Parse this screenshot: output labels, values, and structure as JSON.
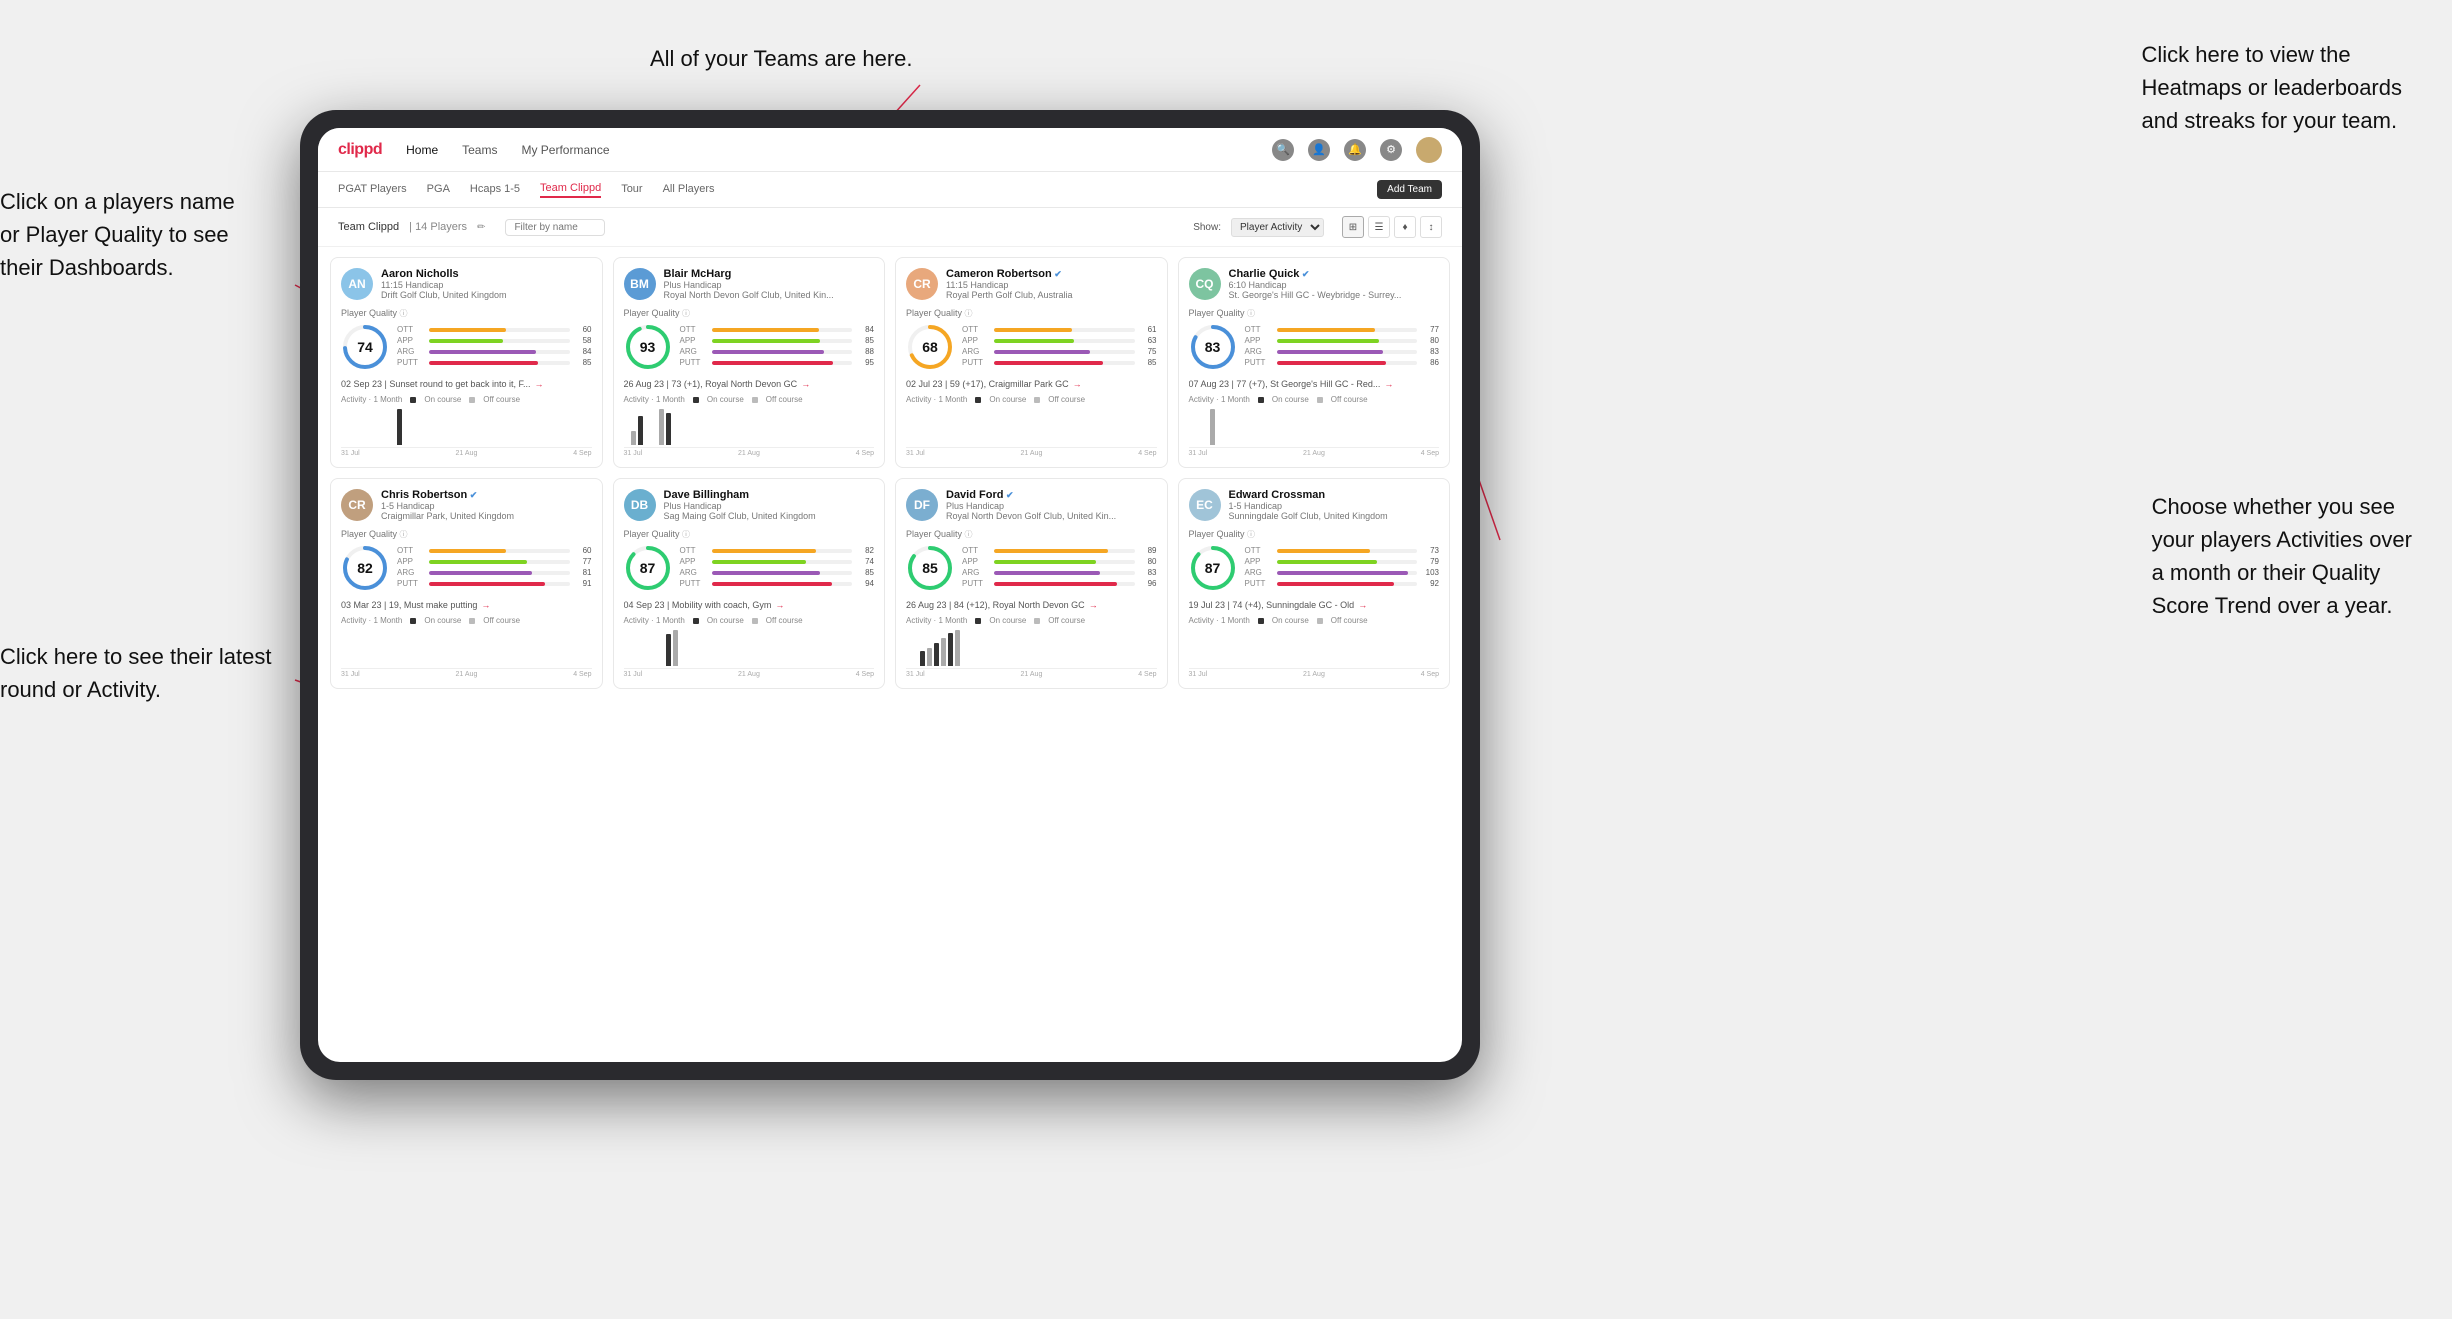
{
  "annotations": {
    "top_center": "All of your Teams are here.",
    "top_right_title": "Click here to view the",
    "top_right_line2": "Heatmaps or leaderboards",
    "top_right_line3": "and streaks for your team.",
    "left_top_title": "Click on a players name",
    "left_top_line2": "or Player Quality to see",
    "left_top_line3": "their Dashboards.",
    "left_bottom_title": "Click here to see their latest",
    "left_bottom_line2": "round or Activity.",
    "right_bottom_title": "Choose whether you see",
    "right_bottom_line2": "your players Activities over",
    "right_bottom_line3": "a month or their Quality",
    "right_bottom_line4": "Score Trend over a year."
  },
  "nav": {
    "logo": "clippd",
    "items": [
      "Home",
      "Teams",
      "My Performance"
    ],
    "add_team": "Add Team"
  },
  "sub_nav": {
    "items": [
      "PGAT Players",
      "PGA",
      "Hcaps 1-5",
      "Team Clippd",
      "Tour",
      "All Players"
    ]
  },
  "team_header": {
    "title": "Team Clippd",
    "count": "14 Players",
    "show_label": "Show:",
    "show_value": "Player Activity",
    "filter_placeholder": "Filter by name"
  },
  "players": [
    {
      "name": "Aaron Nicholls",
      "handicap": "11:15 Handicap",
      "club": "Drift Golf Club, United Kingdom",
      "quality": 74,
      "color": "#4a90d9",
      "stats": [
        {
          "label": "OTT",
          "value": 60,
          "color": "#f5a623"
        },
        {
          "label": "APP",
          "value": 58,
          "color": "#7ed321"
        },
        {
          "label": "ARG",
          "value": 84,
          "color": "#9b59b6"
        },
        {
          "label": "PUTT",
          "value": 85,
          "color": "#e0294a"
        }
      ],
      "last_round": "02 Sep 23 | Sunset round to get back into it, F...",
      "activity_bars": [
        0,
        0,
        0,
        0,
        0,
        0,
        0,
        0,
        14,
        0
      ],
      "dates": [
        "31 Jul",
        "21 Aug",
        "4 Sep"
      ],
      "avatar_color": "#8bc4e8",
      "initials": "AN"
    },
    {
      "name": "Blair McHarg",
      "handicap": "Plus Handicap",
      "club": "Royal North Devon Golf Club, United Kin...",
      "quality": 93,
      "color": "#2ecc71",
      "stats": [
        {
          "label": "OTT",
          "value": 84,
          "color": "#f5a623"
        },
        {
          "label": "APP",
          "value": 85,
          "color": "#7ed321"
        },
        {
          "label": "ARG",
          "value": 88,
          "color": "#9b59b6"
        },
        {
          "label": "PUTT",
          "value": 95,
          "color": "#e0294a"
        }
      ],
      "last_round": "26 Aug 23 | 73 (+1), Royal North Devon GC",
      "activity_bars": [
        0,
        8,
        16,
        0,
        0,
        20,
        18,
        0,
        0,
        0
      ],
      "dates": [
        "31 Jul",
        "21 Aug",
        "4 Sep"
      ],
      "avatar_color": "#5b9bd5",
      "initials": "BM"
    },
    {
      "name": "Cameron Robertson",
      "handicap": "11:15 Handicap",
      "club": "Royal Perth Golf Club, Australia",
      "quality": 68,
      "color": "#f5a623",
      "stats": [
        {
          "label": "OTT",
          "value": 61,
          "color": "#f5a623"
        },
        {
          "label": "APP",
          "value": 63,
          "color": "#7ed321"
        },
        {
          "label": "ARG",
          "value": 75,
          "color": "#9b59b6"
        },
        {
          "label": "PUTT",
          "value": 85,
          "color": "#e0294a"
        }
      ],
      "last_round": "02 Jul 23 | 59 (+17), Craigmillar Park GC",
      "activity_bars": [
        0,
        0,
        0,
        0,
        0,
        0,
        0,
        0,
        0,
        0
      ],
      "dates": [
        "31 Jul",
        "21 Aug",
        "4 Sep"
      ],
      "avatar_color": "#e8a87c",
      "initials": "CR",
      "verified": true
    },
    {
      "name": "Charlie Quick",
      "handicap": "6:10 Handicap",
      "club": "St. George's Hill GC - Weybridge - Surrey...",
      "quality": 83,
      "color": "#4a90d9",
      "stats": [
        {
          "label": "OTT",
          "value": 77,
          "color": "#f5a623"
        },
        {
          "label": "APP",
          "value": 80,
          "color": "#7ed321"
        },
        {
          "label": "ARG",
          "value": 83,
          "color": "#9b59b6"
        },
        {
          "label": "PUTT",
          "value": 86,
          "color": "#e0294a"
        }
      ],
      "last_round": "07 Aug 23 | 77 (+7), St George's Hill GC - Red...",
      "activity_bars": [
        0,
        0,
        0,
        9,
        0,
        0,
        0,
        0,
        0,
        0
      ],
      "dates": [
        "31 Jul",
        "21 Aug",
        "4 Sep"
      ],
      "avatar_color": "#7dc4a0",
      "initials": "CQ",
      "verified": true
    },
    {
      "name": "Chris Robertson",
      "handicap": "1-5 Handicap",
      "club": "Craigmillar Park, United Kingdom",
      "quality": 82,
      "color": "#4a90d9",
      "stats": [
        {
          "label": "OTT",
          "value": 60,
          "color": "#f5a623"
        },
        {
          "label": "APP",
          "value": 77,
          "color": "#7ed321"
        },
        {
          "label": "ARG",
          "value": 81,
          "color": "#9b59b6"
        },
        {
          "label": "PUTT",
          "value": 91,
          "color": "#e0294a"
        }
      ],
      "last_round": "03 Mar 23 | 19, Must make putting",
      "activity_bars": [
        0,
        0,
        0,
        0,
        0,
        0,
        0,
        0,
        0,
        0
      ],
      "dates": [
        "31 Jul",
        "21 Aug",
        "4 Sep"
      ],
      "avatar_color": "#c09f7e",
      "initials": "CR",
      "verified": true
    },
    {
      "name": "Dave Billingham",
      "handicap": "Plus Handicap",
      "club": "Sag Maing Golf Club, United Kingdom",
      "quality": 87,
      "color": "#2ecc71",
      "stats": [
        {
          "label": "OTT",
          "value": 82,
          "color": "#f5a623"
        },
        {
          "label": "APP",
          "value": 74,
          "color": "#7ed321"
        },
        {
          "label": "ARG",
          "value": 85,
          "color": "#9b59b6"
        },
        {
          "label": "PUTT",
          "value": 94,
          "color": "#e0294a"
        }
      ],
      "last_round": "04 Sep 23 | Mobility with coach, Gym",
      "activity_bars": [
        0,
        0,
        0,
        0,
        0,
        0,
        14,
        16,
        0,
        0
      ],
      "dates": [
        "31 Jul",
        "21 Aug",
        "4 Sep"
      ],
      "avatar_color": "#6aafcf",
      "initials": "DB"
    },
    {
      "name": "David Ford",
      "handicap": "Plus Handicap",
      "club": "Royal North Devon Golf Club, United Kin...",
      "quality": 85,
      "color": "#2ecc71",
      "stats": [
        {
          "label": "OTT",
          "value": 89,
          "color": "#f5a623"
        },
        {
          "label": "APP",
          "value": 80,
          "color": "#7ed321"
        },
        {
          "label": "ARG",
          "value": 83,
          "color": "#9b59b6"
        },
        {
          "label": "PUTT",
          "value": 96,
          "color": "#e0294a"
        }
      ],
      "last_round": "26 Aug 23 | 84 (+12), Royal North Devon GC",
      "activity_bars": [
        0,
        0,
        12,
        14,
        18,
        22,
        26,
        28,
        0,
        0
      ],
      "dates": [
        "31 Jul",
        "21 Aug",
        "4 Sep"
      ],
      "avatar_color": "#7baed0",
      "initials": "DF",
      "verified": true
    },
    {
      "name": "Edward Crossman",
      "handicap": "1-5 Handicap",
      "club": "Sunningdale Golf Club, United Kingdom",
      "quality": 87,
      "color": "#2ecc71",
      "stats": [
        {
          "label": "OTT",
          "value": 73,
          "color": "#f5a623"
        },
        {
          "label": "APP",
          "value": 79,
          "color": "#7ed321"
        },
        {
          "label": "ARG",
          "value": 103,
          "color": "#9b59b6"
        },
        {
          "label": "PUTT",
          "value": 92,
          "color": "#e0294a"
        }
      ],
      "last_round": "19 Jul 23 | 74 (+4), Sunningdale GC - Old",
      "activity_bars": [
        0,
        0,
        0,
        0,
        0,
        0,
        0,
        0,
        0,
        0
      ],
      "dates": [
        "31 Jul",
        "21 Aug",
        "4 Sep"
      ],
      "avatar_color": "#a0c4d8",
      "initials": "EC"
    }
  ],
  "colors": {
    "accent": "#e0294a",
    "green": "#2ecc71",
    "blue": "#4a90d9",
    "orange": "#f5a623",
    "purple": "#9b59b6",
    "oncourse": "#333",
    "offcourse": "#aaa"
  }
}
